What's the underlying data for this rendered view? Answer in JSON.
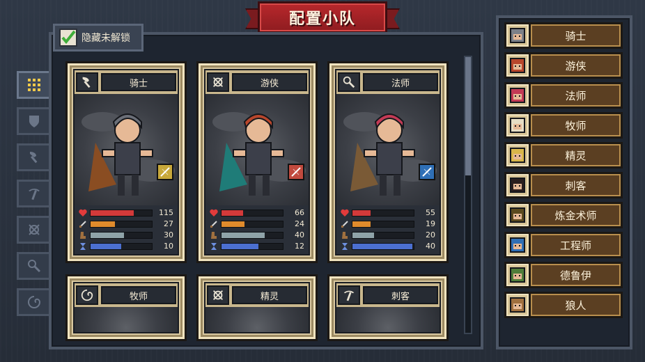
{
  "title": "配置小队",
  "hide_locked": {
    "label": "隐藏未解锁",
    "checked": true
  },
  "tabs": [
    {
      "name": "all",
      "icon": "grid-icon",
      "active": true
    },
    {
      "name": "tank",
      "icon": "shield-icon",
      "active": false
    },
    {
      "name": "melee",
      "icon": "axe-icon",
      "active": false
    },
    {
      "name": "ranged",
      "icon": "pickaxe-icon",
      "active": false
    },
    {
      "name": "bow",
      "icon": "bow-icon",
      "active": false
    },
    {
      "name": "magic",
      "icon": "wand-icon",
      "active": false
    },
    {
      "name": "support",
      "icon": "swirl-icon",
      "active": false
    }
  ],
  "cards": [
    {
      "name": "骑士",
      "icon": "axe-icon",
      "hp": "115",
      "atk": "27",
      "def": "30",
      "spd": "10",
      "hp_frac": 0.7,
      "atk_frac": 0.4,
      "def_frac": 0.55,
      "spd_frac": 0.5,
      "badge_color": "#c8a83a",
      "hair": "#6b6f78",
      "cloak": "#8a4d22"
    },
    {
      "name": "游侠",
      "icon": "bow-icon",
      "hp": "66",
      "atk": "24",
      "def": "40",
      "spd": "12",
      "hp_frac": 0.35,
      "atk_frac": 0.38,
      "def_frac": 0.7,
      "spd_frac": 0.6,
      "badge_color": "#c14a3e",
      "hair": "#b8462c",
      "cloak": "#1f7c78"
    },
    {
      "name": "法师",
      "icon": "wand-icon",
      "hp": "55",
      "atk": "19",
      "def": "20",
      "spd": "40",
      "hp_frac": 0.3,
      "atk_frac": 0.3,
      "def_frac": 0.35,
      "spd_frac": 0.98,
      "badge_color": "#2f6fb6",
      "hair": "#c33a55",
      "cloak": "#7a5a36"
    },
    {
      "name": "牧师",
      "icon": "swirl-icon"
    },
    {
      "name": "精灵",
      "icon": "bow-icon"
    },
    {
      "name": "刺客",
      "icon": "pickaxe-icon"
    }
  ],
  "roster": [
    {
      "label": "骑士",
      "portrait": "knight-portrait",
      "color": "#7c8088"
    },
    {
      "label": "游侠",
      "portrait": "ranger-portrait",
      "color": "#b8462c"
    },
    {
      "label": "法师",
      "portrait": "mage-portrait",
      "color": "#c33a55"
    },
    {
      "label": "牧师",
      "portrait": "priest-portrait",
      "color": "#e6ddc4"
    },
    {
      "label": "精灵",
      "portrait": "elf-portrait",
      "color": "#d8b64a"
    },
    {
      "label": "刺客",
      "portrait": "assassin-portrait",
      "color": "#2b1f1f"
    },
    {
      "label": "炼金术师",
      "portrait": "alchemist-portrait",
      "color": "#5b4a1f"
    },
    {
      "label": "工程师",
      "portrait": "engineer-portrait",
      "color": "#2f6fb6"
    },
    {
      "label": "德鲁伊",
      "portrait": "druid-portrait",
      "color": "#4f7d3a"
    },
    {
      "label": "狼人",
      "portrait": "werewolf-portrait",
      "color": "#a0703f"
    }
  ],
  "colors": {
    "hp": "#d33a3a",
    "atk": "#e08b2c",
    "def": "#8fa3a8",
    "spd": "#4b6fd0"
  }
}
